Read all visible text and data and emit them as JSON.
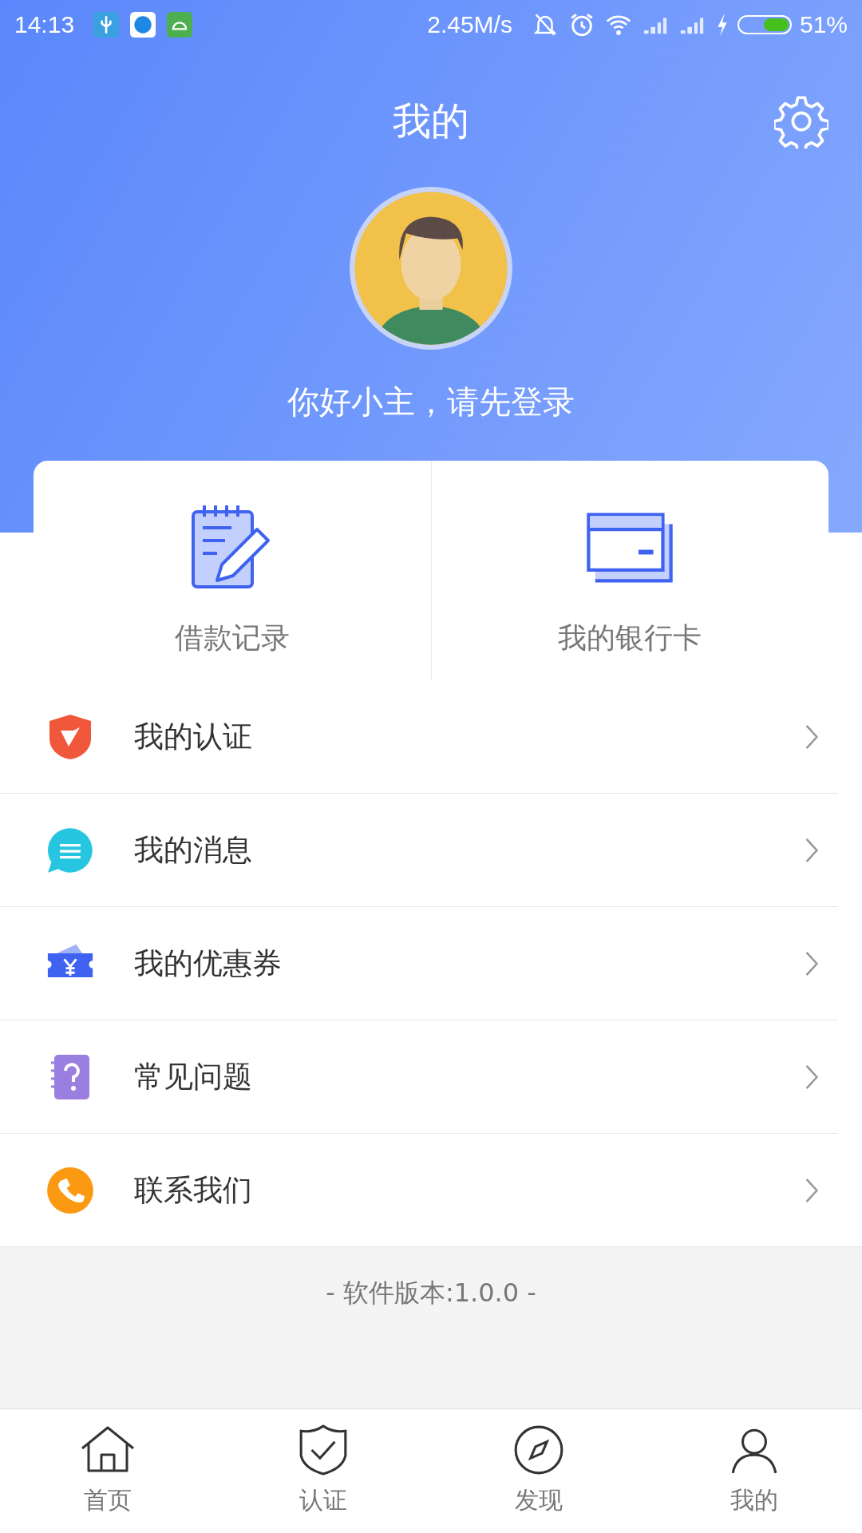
{
  "status_bar": {
    "time": "14:13",
    "speed": "2.45M/s",
    "battery_text": "51%"
  },
  "header": {
    "title": "我的",
    "greeting": "你好小主，请先登录"
  },
  "shortcuts": [
    {
      "kind": "notepad",
      "label": "借款记录"
    },
    {
      "kind": "card",
      "label": "我的银行卡"
    }
  ],
  "menu": [
    {
      "kind": "shield",
      "label": "我的认证"
    },
    {
      "kind": "message",
      "label": "我的消息"
    },
    {
      "kind": "coupon",
      "label": "我的优惠券"
    },
    {
      "kind": "question",
      "label": "常见问题"
    },
    {
      "kind": "phone",
      "label": "联系我们"
    }
  ],
  "version": "- 软件版本:1.0.0 -",
  "tabs": [
    {
      "kind": "home",
      "label": "首页"
    },
    {
      "kind": "shield",
      "label": "认证"
    },
    {
      "kind": "discover",
      "label": "发现"
    },
    {
      "kind": "mine",
      "label": "我的"
    }
  ]
}
